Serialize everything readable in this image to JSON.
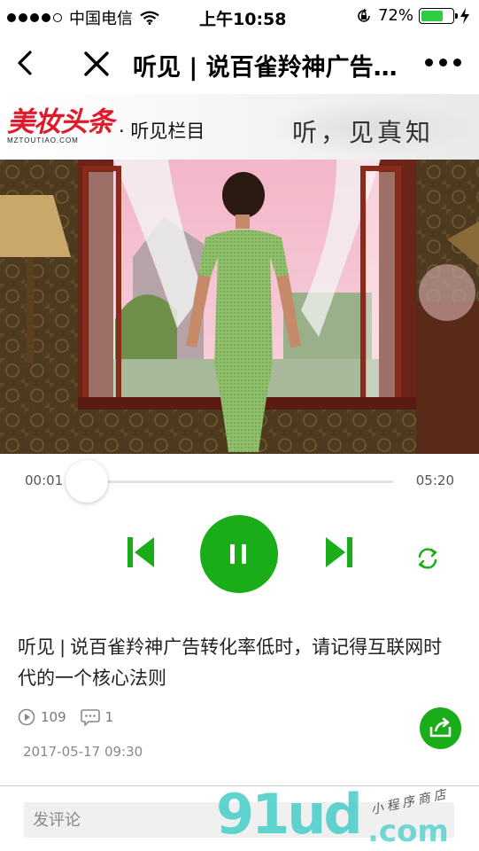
{
  "status_bar": {
    "carrier": "中国电信",
    "time": "上午10:58",
    "battery_percent": "72%",
    "battery_level": 0.72
  },
  "nav": {
    "title": "听见 | 说百雀羚神广告转化率低时，请记得互联网时代的一个核心法则",
    "icons": [
      "chevron-left-icon",
      "close-icon",
      "more-icon"
    ]
  },
  "banner": {
    "logo_text": "美妆头条",
    "logo_sub": "MZTOUTIAO.COM",
    "column_label": "· 听见栏目",
    "slogan": "听，见真知"
  },
  "player": {
    "elapsed": "00:01",
    "duration": "05:20",
    "progress_fraction": 0.003,
    "state": "playing",
    "accent_color": "#1aad19"
  },
  "article": {
    "title": "听见 | 说百雀羚神广告转化率低时，请记得互联网时代的一个核心法则",
    "play_count": "109",
    "comment_count": "1",
    "date": "2017-05-17 09:30"
  },
  "comment": {
    "placeholder": "发评论"
  },
  "watermark": {
    "main": "91ud",
    "suffix": ".com",
    "small": "小程序商店"
  }
}
